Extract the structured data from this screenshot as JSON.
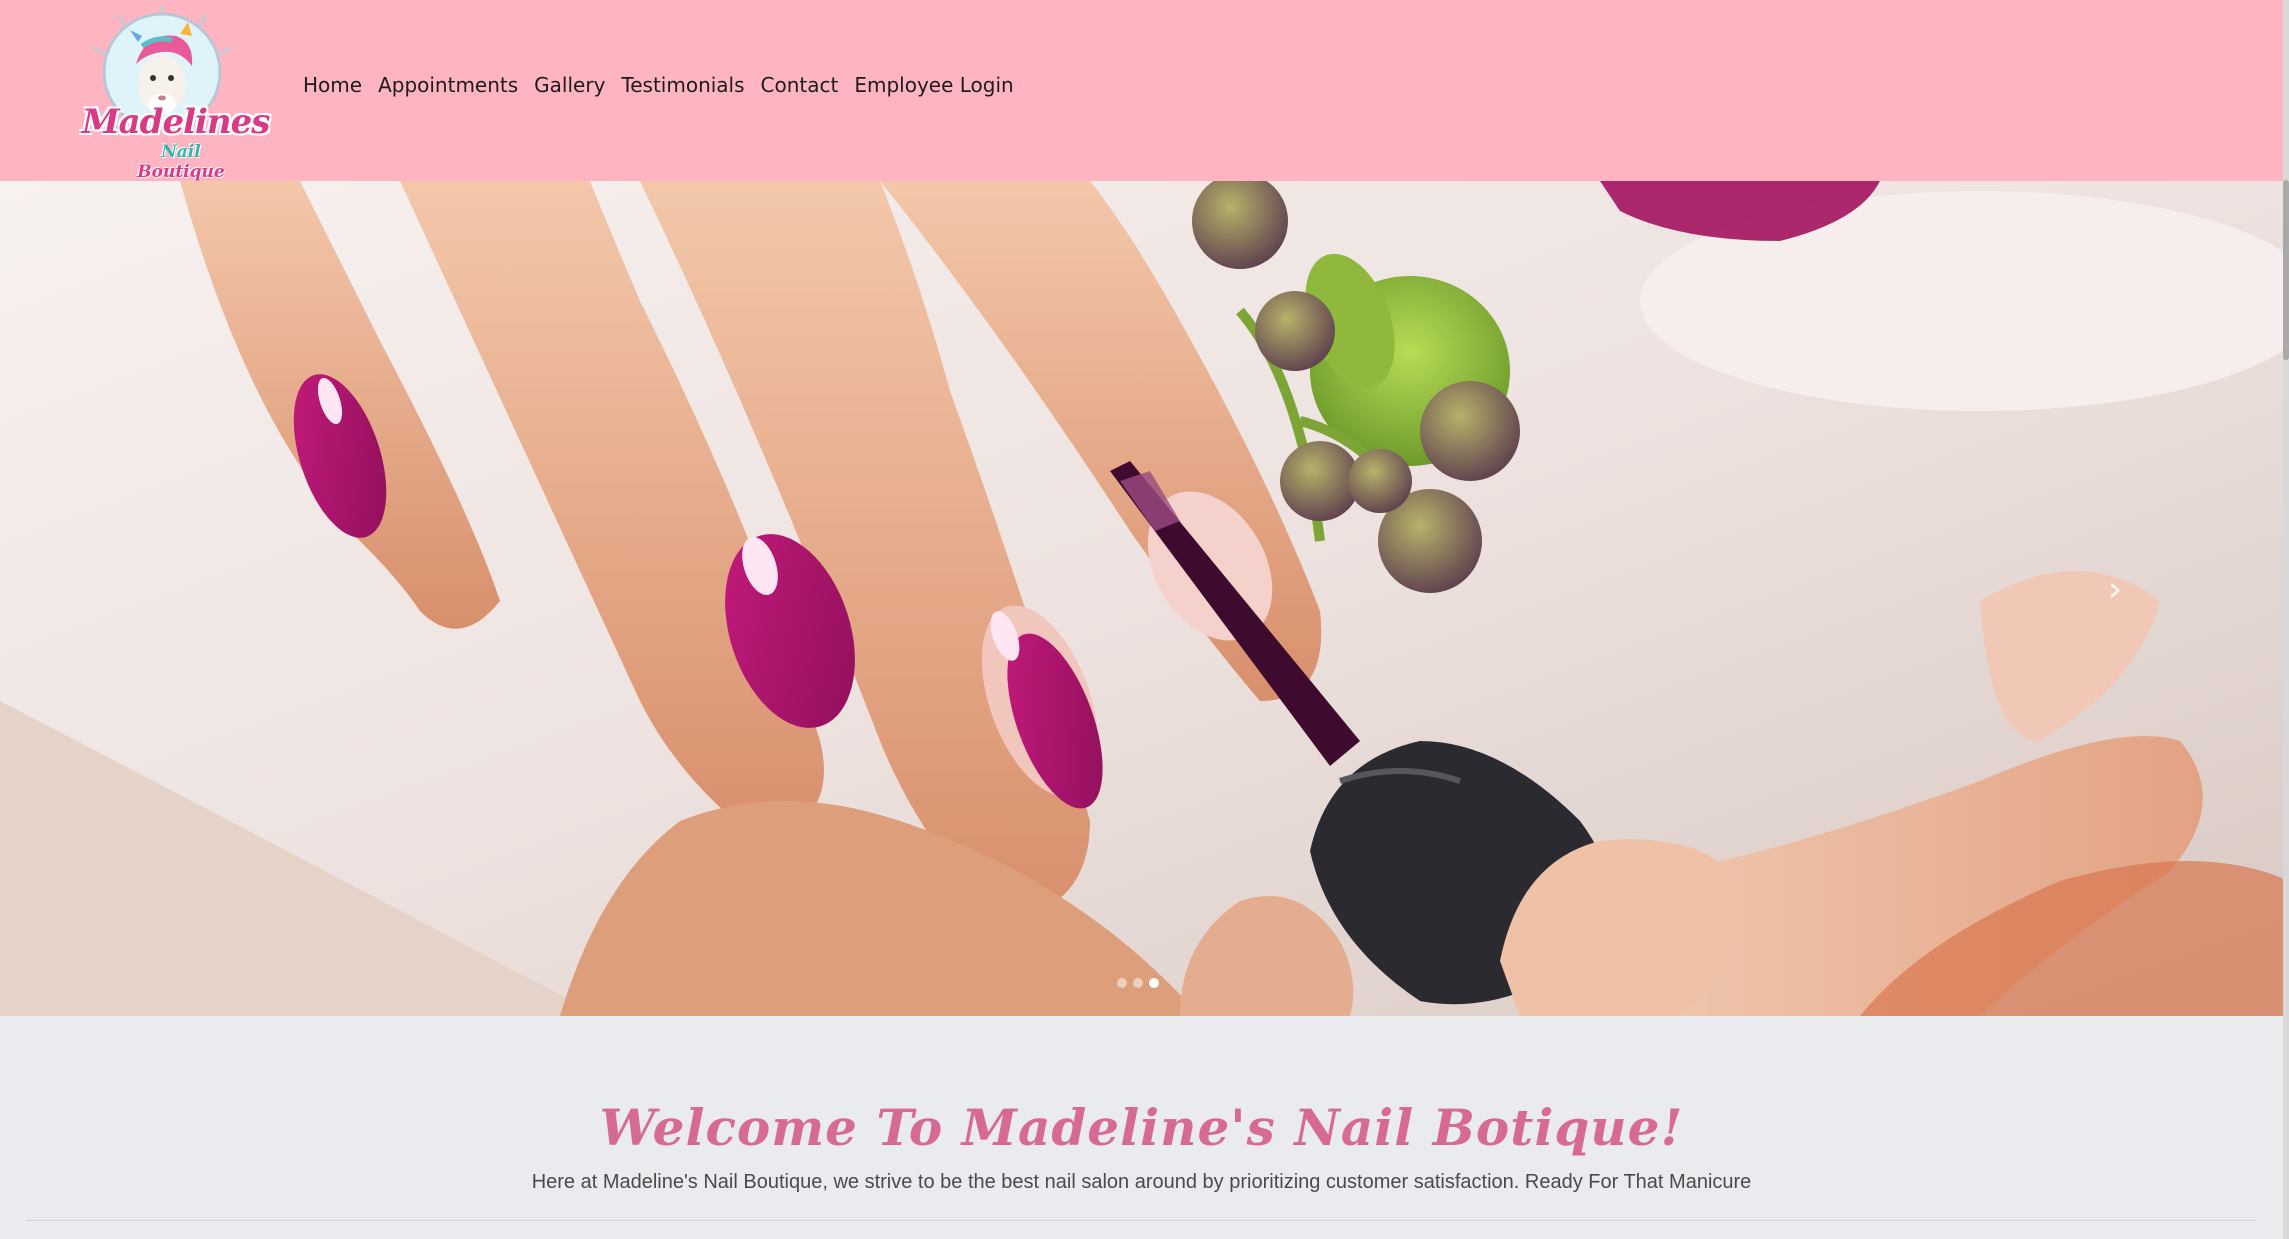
{
  "brand": {
    "logo_primary": "Madelines",
    "logo_secondary_a": "Nail",
    "logo_secondary_b": "Boutique",
    "pink": "#d93a86",
    "teal": "#2fb7b0",
    "header_bg": "#ffb5c1"
  },
  "nav": {
    "items": [
      "Home",
      "Appointments",
      "Gallery",
      "Testimonials",
      "Contact",
      "Employee Login"
    ]
  },
  "carousel": {
    "next_icon": "chevron-right-icon",
    "indicator_count": 3,
    "active_index": 2
  },
  "main": {
    "welcome_title": "Welcome To Madeline's Nail Botique!",
    "intro_text": "Here at Madeline's Nail Boutique, we strive to be the best nail salon around by prioritizing customer satisfaction. Ready For That Manicure"
  }
}
